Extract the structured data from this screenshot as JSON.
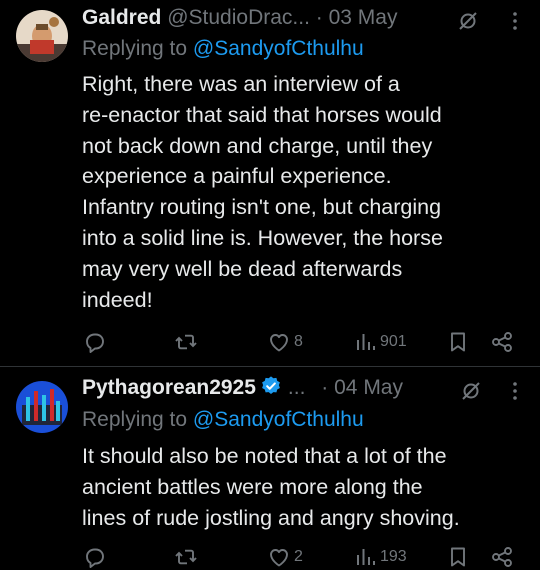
{
  "tweets": [
    {
      "author_name": "Galdred",
      "handle": "@StudioDrac...",
      "separator": "·",
      "date": "03 May",
      "replying_prefix": "Replying to",
      "replying_to": "@SandyofCthulhu",
      "text_lines": [
        "Right, there was an interview of a",
        "re-enactor that said that horses would",
        "not back down and charge, until they",
        "experience a painful experience.",
        "Infantry routing isn't one, but charging",
        "into a solid line is. However, the horse",
        "may very well be dead afterwards",
        "indeed!"
      ],
      "actions": {
        "reply_count": "",
        "retweet_count": "",
        "like_count": "8",
        "views_count": "901"
      }
    },
    {
      "author_name": "Pythagorean2925",
      "verified": true,
      "name_ellipsis": "...",
      "separator": "·",
      "date": "04 May",
      "replying_prefix": "Replying to",
      "replying_to": "@SandyofCthulhu",
      "text_lines": [
        "It should also be noted that a lot of the",
        "ancient battles were more along the",
        "lines of rude jostling and angry shoving."
      ],
      "actions": {
        "reply_count": "",
        "retweet_count": "",
        "like_count": "2",
        "views_count": "193"
      }
    }
  ],
  "colors": {
    "background": "#000000",
    "text_primary": "#e7e9ea",
    "text_secondary": "#71767b",
    "link": "#1d9bf0",
    "verified": "#1d9bf0",
    "divider": "#2f3336"
  },
  "icons": [
    "grok-icon",
    "more-icon",
    "reply-icon",
    "retweet-icon",
    "like-icon",
    "views-icon",
    "bookmark-icon",
    "share-icon",
    "verified-badge-icon"
  ]
}
